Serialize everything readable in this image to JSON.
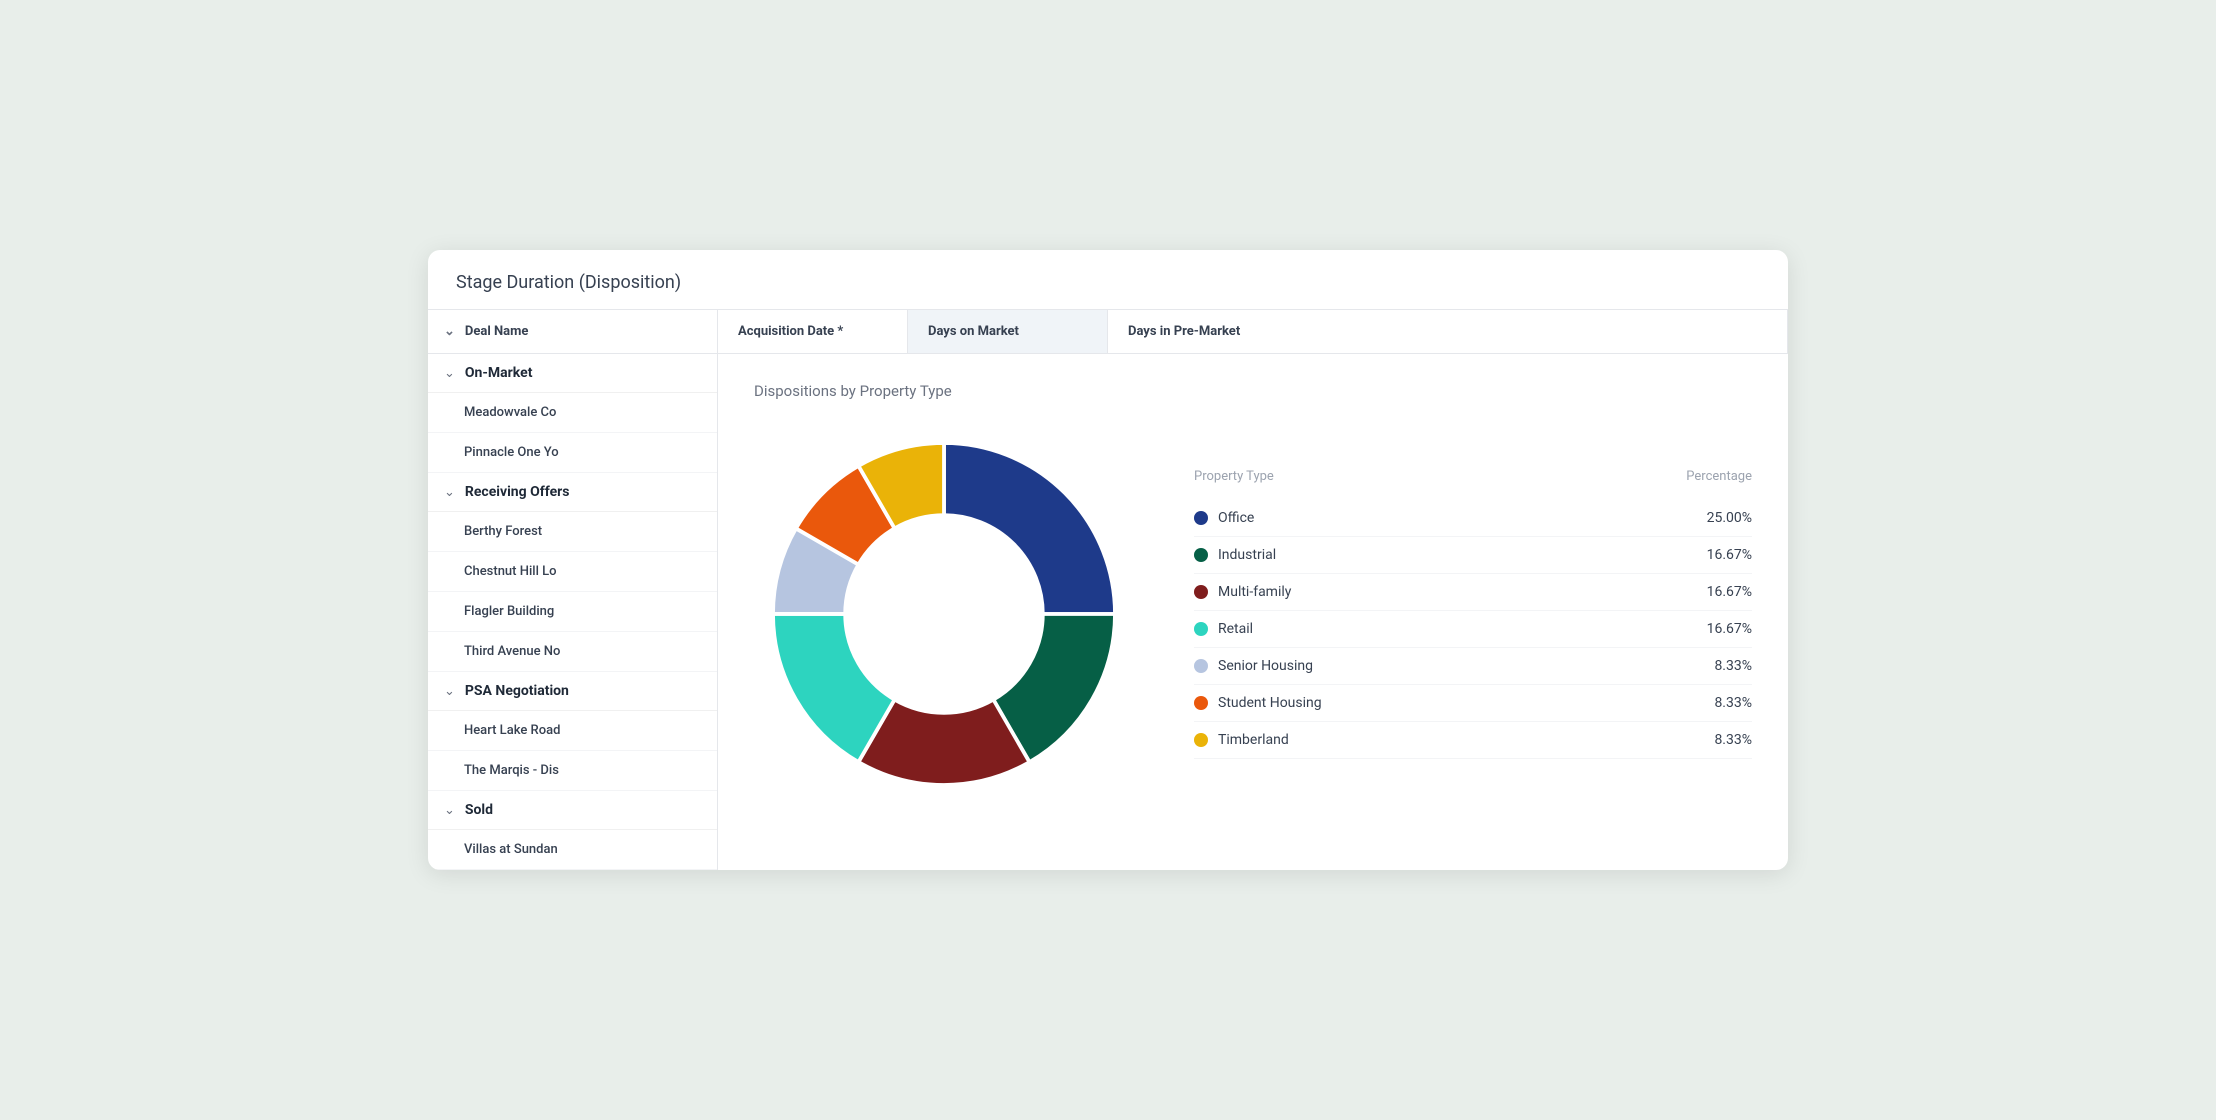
{
  "card": {
    "title": "Stage Duration (Disposition)"
  },
  "table": {
    "col_deal_name": "Deal Name",
    "col_acquisition": "Acquisition Date *",
    "col_days_market": "Days on Market",
    "col_days_premarket": "Days in Pre-Market"
  },
  "groups": [
    {
      "id": "on-market",
      "label": "On-Market",
      "items": [
        {
          "name": "Meadowvale Co"
        },
        {
          "name": "Pinnacle One Yo"
        }
      ]
    },
    {
      "id": "receiving-offers",
      "label": "Receiving Offers",
      "items": [
        {
          "name": "Berthy Forest"
        },
        {
          "name": "Chestnut Hill Lo"
        },
        {
          "name": "Flagler Building"
        },
        {
          "name": "Third Avenue No"
        }
      ]
    },
    {
      "id": "psa-negotiation",
      "label": "PSA Negotiation",
      "items": [
        {
          "name": "Heart Lake Road"
        },
        {
          "name": "The Marqis - Dis"
        }
      ]
    },
    {
      "id": "sold",
      "label": "Sold",
      "items": [
        {
          "name": "Villas at Sundan"
        }
      ]
    }
  ],
  "chart": {
    "title": "Dispositions by Property Type",
    "legend_header_type": "Property Type",
    "legend_header_pct": "Percentage",
    "segments": [
      {
        "label": "Office",
        "pct": 25.0,
        "pct_str": "25.00%",
        "color": "#1e3a8a"
      },
      {
        "label": "Industrial",
        "pct": 16.67,
        "pct_str": "16.67%",
        "color": "#065f46"
      },
      {
        "label": "Multi-family",
        "pct": 16.67,
        "pct_str": "16.67%",
        "color": "#7f1d1d"
      },
      {
        "label": "Retail",
        "pct": 16.67,
        "pct_str": "16.67%",
        "color": "#2dd4bf"
      },
      {
        "label": "Senior Housing",
        "pct": 8.33,
        "pct_str": "8.33%",
        "color": "#b6c5e0"
      },
      {
        "label": "Student Housing",
        "pct": 8.33,
        "pct_str": "8.33%",
        "color": "#ea580c"
      },
      {
        "label": "Timberland",
        "pct": 8.33,
        "pct_str": "8.33%",
        "color": "#eab308"
      }
    ]
  }
}
